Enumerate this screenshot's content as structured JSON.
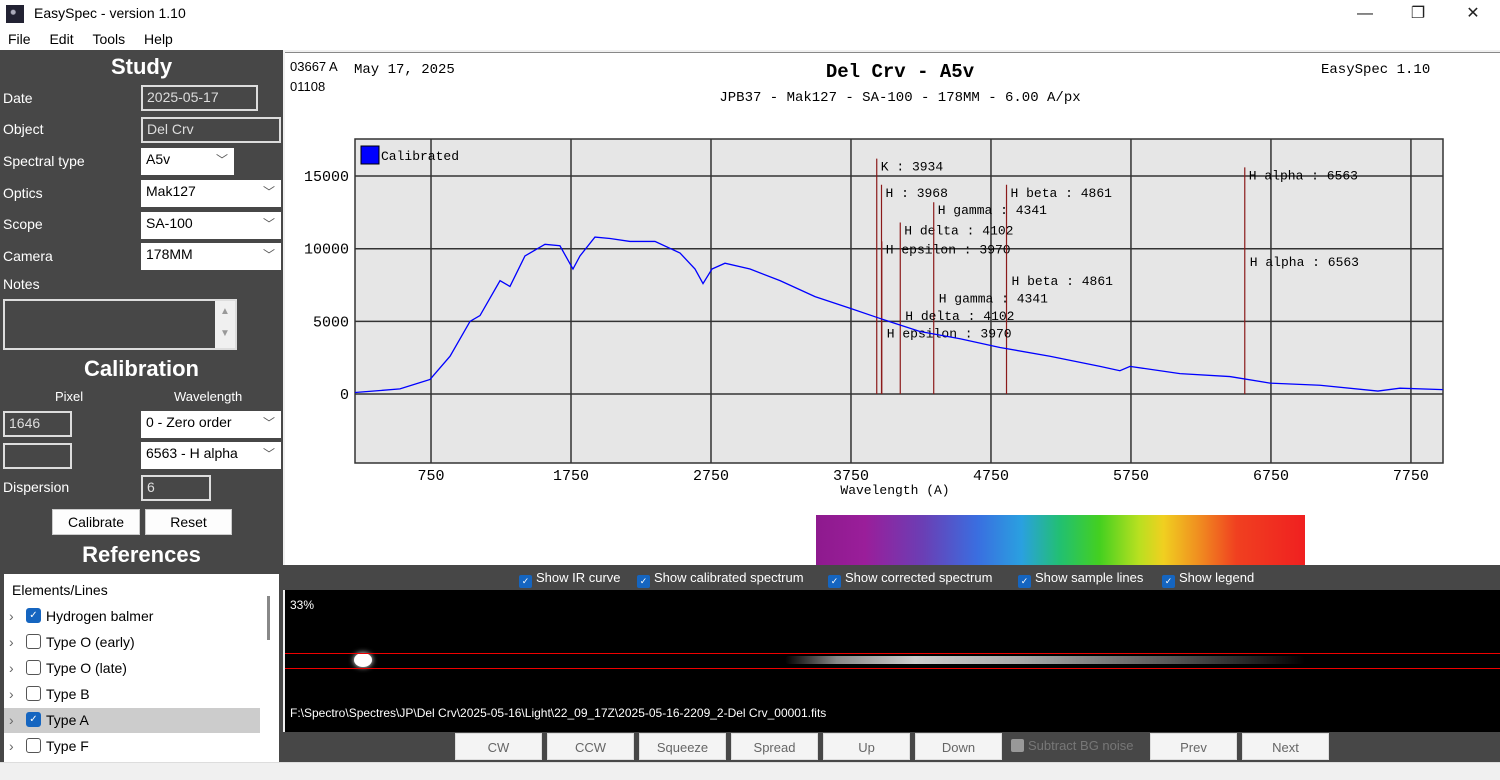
{
  "window": {
    "title": "EasySpec - version 1.10",
    "minimize": "—",
    "maximize": "❐",
    "close": "✕"
  },
  "menu": [
    "File",
    "Edit",
    "Tools",
    "Help"
  ],
  "study": {
    "heading": "Study",
    "date_label": "Date",
    "date": "2025-05-17",
    "object_label": "Object",
    "object": "Del Crv",
    "spectral_type_label": "Spectral type",
    "spectral_type": "A5v",
    "optics_label": "Optics",
    "optics": "Mak127",
    "scope_label": "Scope",
    "scope": "SA-100",
    "camera_label": "Camera",
    "camera": "178MM",
    "notes_label": "Notes",
    "notes": ""
  },
  "calibration": {
    "heading": "Calibration",
    "pixel_label": "Pixel",
    "wavelength_label": "Wavelength",
    "pixel1": "1646",
    "pixel2": "",
    "wavelength1": "0 - Zero order",
    "wavelength2": "6563 - H alpha",
    "dispersion_label": "Dispersion",
    "dispersion": "6",
    "calibrate": "Calibrate",
    "reset": "Reset"
  },
  "references": {
    "heading": "References",
    "column": "Elements/Lines",
    "items": [
      {
        "label": "Hydrogen balmer",
        "checked": true
      },
      {
        "label": "Type O (early)",
        "checked": false
      },
      {
        "label": "Type O (late)",
        "checked": false
      },
      {
        "label": "Type B",
        "checked": false
      },
      {
        "label": "Type A",
        "checked": true
      },
      {
        "label": "Type F",
        "checked": false
      }
    ]
  },
  "chart_header": {
    "cursor_wl": "03667 A",
    "cursor_px": "01108",
    "date": "May 17, 2025",
    "app": "EasySpec 1.10"
  },
  "chart_data": {
    "type": "line",
    "title": "Del Crv - A5v",
    "subtitle": "JPB37 - Mak127 - SA-100 - 178MM - 6.00 A/px",
    "xlabel": "Wavelength (A)",
    "ylabel": "",
    "xlim": [
      207,
      7979
    ],
    "ylim": [
      -4750,
      17550
    ],
    "xticks": [
      750,
      1750,
      2750,
      3750,
      4750,
      5750,
      6750,
      7750
    ],
    "yticks": [
      0,
      5000,
      10000,
      15000
    ],
    "grid": true,
    "legend": "top-left",
    "series": [
      {
        "name": "Calibrated",
        "color": "#0000ff",
        "x": [
          207,
          528,
          743,
          886,
          1029,
          1100,
          1243,
          1314,
          1421,
          1564,
          1671,
          1764,
          1814,
          1921,
          2029,
          2171,
          2350,
          2529,
          2636,
          2693,
          2757,
          2850,
          3029,
          3243,
          3493,
          3743,
          3957,
          4243,
          4529,
          4814,
          5171,
          5529,
          5671,
          5743,
          6100,
          6457,
          6743,
          7100,
          7514,
          7671,
          7979
        ],
        "y": [
          100,
          350,
          1000,
          2600,
          5000,
          5400,
          7800,
          7400,
          9500,
          10300,
          10200,
          8600,
          9500,
          10800,
          10700,
          10500,
          10500,
          9700,
          8600,
          7600,
          8600,
          9000,
          8600,
          7800,
          6700,
          5900,
          5200,
          4300,
          3800,
          3200,
          2600,
          1900,
          1600,
          1900,
          1400,
          1200,
          750,
          600,
          200,
          400,
          300
        ]
      }
    ],
    "lines": [
      {
        "name": "K",
        "wl": 3934,
        "label": "K : 3934",
        "top": 16200
      },
      {
        "name": "H",
        "wl": 3968,
        "label": "H : 3968",
        "top": 14400
      },
      {
        "name": "H epsilon",
        "wl": 3970,
        "label": "H epsilon : 3970",
        "top": 10500
      },
      {
        "name": "H delta",
        "wl": 4102,
        "label": "H delta : 4102",
        "top": 11800
      },
      {
        "name": "H gamma",
        "wl": 4341,
        "label": "H gamma : 4341",
        "top": 13200
      },
      {
        "name": "H beta",
        "wl": 4861,
        "label": "H beta : 4861",
        "top": 14400
      },
      {
        "name": "H alpha",
        "wl": 6563,
        "label": "H alpha : 6563",
        "top": 15600
      }
    ],
    "lines_set2": [
      {
        "label": "H beta : 4861",
        "wl": 4861,
        "y": 7500
      },
      {
        "label": "H gamma : 4341",
        "wl": 4341,
        "y": 6300
      },
      {
        "label": "H delta : 4102",
        "wl": 4102,
        "y": 5100
      },
      {
        "label": "H epsilon : 3970",
        "wl": 3970,
        "y": 3900
      },
      {
        "label": "H alpha : 6563",
        "wl": 6563,
        "y": 8800
      }
    ]
  },
  "options": [
    {
      "label": "Show IR curve"
    },
    {
      "label": "Show calibrated spectrum"
    },
    {
      "label": "Show corrected spectrum"
    },
    {
      "label": "Show sample lines"
    },
    {
      "label": "Show legend"
    }
  ],
  "image": {
    "zoom": "33%",
    "path": "F:\\Spectro\\Spectres\\JP\\Del Crv\\2025-05-16\\Light\\22_09_17Z\\2025-05-16-2209_2-Del Crv_00001.fits"
  },
  "buttons": {
    "cw": "CW",
    "ccw": "CCW",
    "squeeze": "Squeeze",
    "spread": "Spread",
    "up": "Up",
    "down": "Down",
    "subtract": "Subtract BG noise",
    "prev": "Prev",
    "next": "Next"
  },
  "colors": {
    "panel": "#474747",
    "line": "#8b1a1a",
    "spectrum": "#0000ff",
    "plot_bg": "#e6e6e6"
  }
}
